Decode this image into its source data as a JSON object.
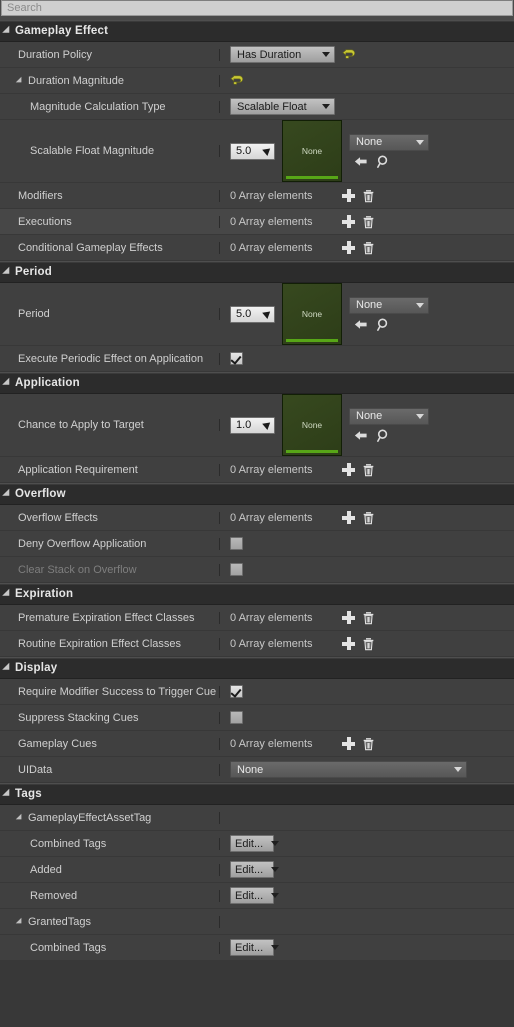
{
  "search": {
    "placeholder": "Search",
    "value": ""
  },
  "icons": {
    "expand": "triangle-expanded-icon",
    "reset": "reset-arrow-icon",
    "add": "plus-icon",
    "delete": "trash-icon",
    "back": "back-arrow-icon",
    "browse": "magnifier-browse-icon",
    "caret": "chevron-down-icon"
  },
  "labels": {
    "array_elements": "0 Array elements",
    "none": "None",
    "edit": "Edit...",
    "thumb_none": "None"
  },
  "sections": [
    {
      "title": "Gameplay Effect",
      "rows": [
        {
          "label": "Duration Policy",
          "indent": 1,
          "type": "combo-reset",
          "value": "Has Duration"
        },
        {
          "label": "Duration Magnitude",
          "indent": 1,
          "type": "reset-only",
          "expander": true
        },
        {
          "label": "Magnitude Calculation Type",
          "indent": 2,
          "type": "combo",
          "value": "Scalable Float"
        },
        {
          "label": "Scalable Float Magnitude",
          "indent": 2,
          "type": "asset",
          "number": "5.0",
          "asset": "None",
          "thumb": "None"
        },
        {
          "label": "Modifiers",
          "indent": 1,
          "type": "array",
          "value": "0 Array elements"
        },
        {
          "label": "Executions",
          "indent": 1,
          "type": "array",
          "value": "0 Array elements",
          "alt": true
        },
        {
          "label": "Conditional Gameplay Effects",
          "indent": 1,
          "type": "array",
          "value": "0 Array elements"
        }
      ]
    },
    {
      "title": "Period",
      "rows": [
        {
          "label": "Period",
          "indent": 1,
          "type": "asset",
          "number": "5.0",
          "asset": "None",
          "thumb": "None"
        },
        {
          "label": "Execute Periodic Effect on Application",
          "indent": 1,
          "type": "checkbox",
          "checked": true
        }
      ]
    },
    {
      "title": "Application",
      "rows": [
        {
          "label": "Chance to Apply to Target",
          "indent": 1,
          "type": "asset",
          "number": "1.0",
          "asset": "None",
          "thumb": "None"
        },
        {
          "label": "Application Requirement",
          "indent": 1,
          "type": "array",
          "value": "0 Array elements"
        }
      ]
    },
    {
      "title": "Overflow",
      "rows": [
        {
          "label": "Overflow Effects",
          "indent": 1,
          "type": "array",
          "value": "0 Array elements"
        },
        {
          "label": "Deny Overflow Application",
          "indent": 1,
          "type": "checkbox",
          "checked": false
        },
        {
          "label": "Clear Stack on Overflow",
          "indent": 1,
          "type": "checkbox",
          "checked": false,
          "disabled": true
        }
      ]
    },
    {
      "title": "Expiration",
      "rows": [
        {
          "label": "Premature Expiration Effect Classes",
          "indent": 1,
          "type": "array",
          "value": "0 Array elements"
        },
        {
          "label": "Routine Expiration Effect Classes",
          "indent": 1,
          "type": "array",
          "value": "0 Array elements"
        }
      ]
    },
    {
      "title": "Display",
      "rows": [
        {
          "label": "Require Modifier Success to Trigger Cue",
          "indent": 1,
          "type": "checkbox",
          "checked": true
        },
        {
          "label": "Suppress Stacking Cues",
          "indent": 1,
          "type": "checkbox",
          "checked": false
        },
        {
          "label": "Gameplay Cues",
          "indent": 1,
          "type": "array",
          "value": "0 Array elements"
        },
        {
          "label": "UIData",
          "indent": 1,
          "type": "combo-wide",
          "value": "None"
        }
      ]
    },
    {
      "title": "Tags",
      "rows": [
        {
          "label": "GameplayEffectAssetTag",
          "indent": 1,
          "type": "group",
          "expander": true
        },
        {
          "label": "Combined Tags",
          "indent": 2,
          "type": "edit",
          "value": "Edit..."
        },
        {
          "label": "Added",
          "indent": 2,
          "type": "edit",
          "value": "Edit..."
        },
        {
          "label": "Removed",
          "indent": 2,
          "type": "edit",
          "value": "Edit..."
        },
        {
          "label": "GrantedTags",
          "indent": 1,
          "type": "group",
          "expander": true
        },
        {
          "label": "Combined Tags",
          "indent": 2,
          "type": "edit",
          "value": "Edit..."
        }
      ]
    }
  ],
  "colors": {
    "panel_bg": "#383838",
    "row_bg": "#404040",
    "row_alt_bg": "#474747",
    "category_bg": "#2c2c2c",
    "accent_green": "#57a617",
    "thumb_green": "#37491f",
    "reset_yellow": "#c8c832"
  }
}
